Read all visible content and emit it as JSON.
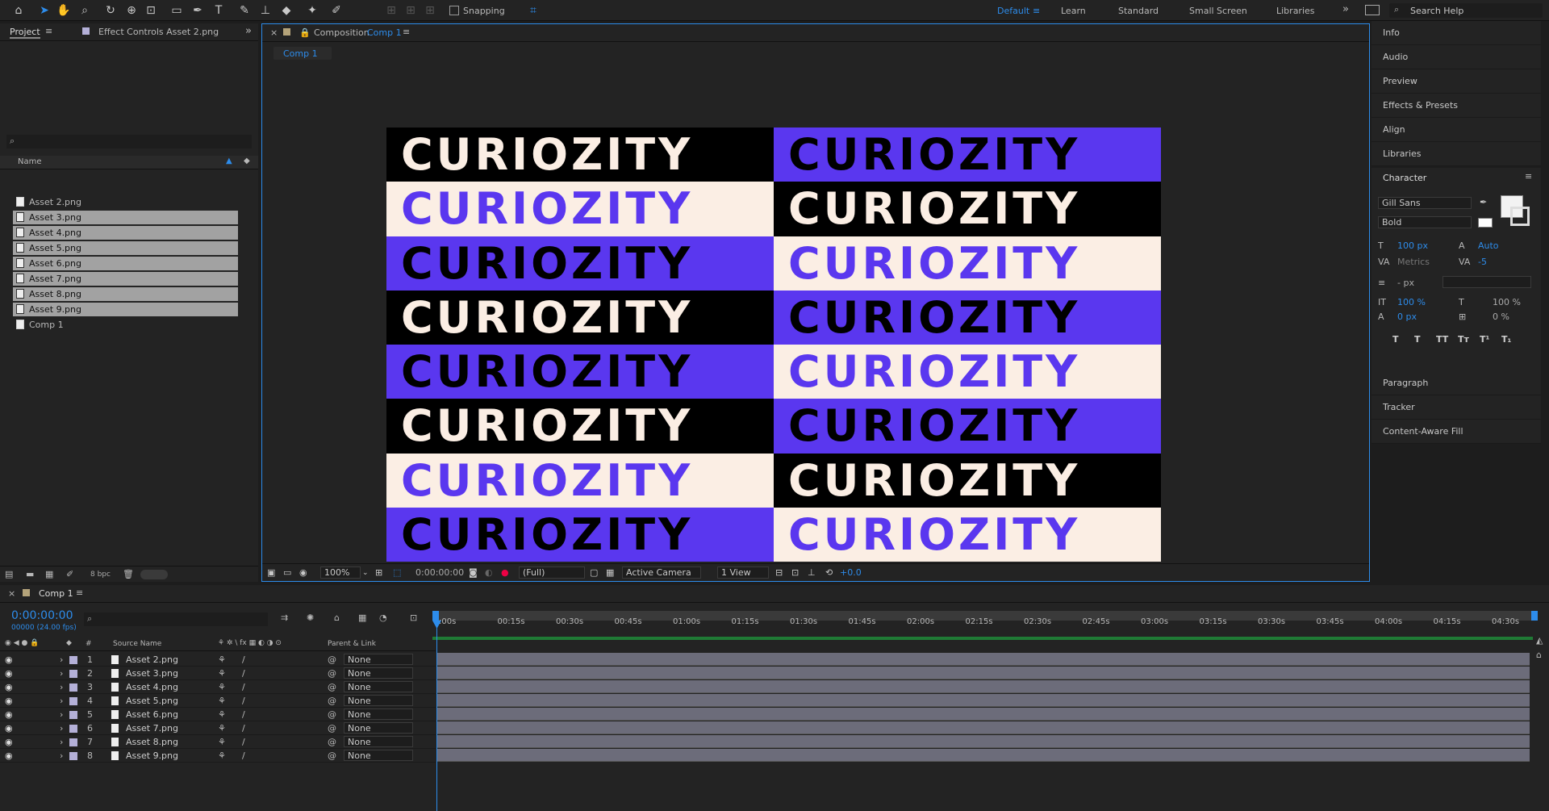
{
  "toolbar": {
    "snapping": "Snapping",
    "workspaces": [
      "Default",
      "Learn",
      "Standard",
      "Small Screen",
      "Libraries"
    ],
    "search_help": "Search Help",
    "active_workspace_color": "#2d8ceb"
  },
  "project_panel": {
    "tab_project": "Project",
    "tab_effect_controls": "Effect Controls Asset 2.png",
    "col_name": "Name",
    "items": [
      {
        "name": "Asset 2.png",
        "selected": false
      },
      {
        "name": "Asset 3.png",
        "selected": true
      },
      {
        "name": "Asset 4.png",
        "selected": true
      },
      {
        "name": "Asset 5.png",
        "selected": true
      },
      {
        "name": "Asset 6.png",
        "selected": true
      },
      {
        "name": "Asset 7.png",
        "selected": true
      },
      {
        "name": "Asset 8.png",
        "selected": true
      },
      {
        "name": "Asset 9.png",
        "selected": true
      },
      {
        "name": "Comp 1",
        "selected": false
      }
    ],
    "bpc": "8 bpc"
  },
  "composition": {
    "tab_prefix": "Composition",
    "tab_name": "Comp 1",
    "sub_tab": "Comp 1",
    "zoom": "100%",
    "timecode": "0:00:00:00",
    "resolution": "(Full)",
    "camera": "Active Camera",
    "views": "1 View",
    "exposure": "+0.0",
    "colors": {
      "purple": "#5a37ef",
      "black": "#000000",
      "cream": "#fbeee4"
    },
    "wordmark": "CURIOZITY",
    "rows": [
      {
        "left": {
          "bg": "black",
          "fg": "cream"
        },
        "right": {
          "bg": "purple",
          "fg": "black"
        }
      },
      {
        "left": {
          "bg": "cream",
          "fg": "purple"
        },
        "right": {
          "bg": "black",
          "fg": "cream"
        }
      },
      {
        "left": {
          "bg": "purple",
          "fg": "black"
        },
        "right": {
          "bg": "cream",
          "fg": "purple"
        }
      },
      {
        "left": {
          "bg": "black",
          "fg": "cream"
        },
        "right": {
          "bg": "purple",
          "fg": "black"
        }
      },
      {
        "left": {
          "bg": "purple",
          "fg": "black"
        },
        "right": {
          "bg": "cream",
          "fg": "purple"
        }
      },
      {
        "left": {
          "bg": "black",
          "fg": "cream"
        },
        "right": {
          "bg": "purple",
          "fg": "black"
        }
      },
      {
        "left": {
          "bg": "cream",
          "fg": "purple"
        },
        "right": {
          "bg": "black",
          "fg": "cream"
        }
      },
      {
        "left": {
          "bg": "purple",
          "fg": "black"
        },
        "right": {
          "bg": "cream",
          "fg": "purple"
        }
      }
    ]
  },
  "right_panel": {
    "items_top": [
      "Info",
      "Audio",
      "Preview",
      "Effects & Presets",
      "Align",
      "Libraries"
    ],
    "character": {
      "title": "Character",
      "font": "Gill Sans",
      "style": "Bold",
      "size": "100 px",
      "leading": "Auto",
      "kerning": "Metrics",
      "tracking": "-5",
      "stroke": "- px",
      "vscale": "100 %",
      "hscale": "100 %",
      "baseline": "0 px",
      "tsume": "0 %",
      "styles": [
        "T",
        "T",
        "TT",
        "Tт",
        "T¹",
        "T₁"
      ]
    },
    "items_bottom": [
      "Paragraph",
      "Tracker",
      "Content-Aware Fill"
    ]
  },
  "timeline": {
    "tab": "Comp 1",
    "timecode": "0:00:00:00",
    "frames": "00000 (24.00 fps)",
    "col_source": "Source Name",
    "col_parent": "Parent & Link",
    "ticks": [
      ":00s",
      "00:15s",
      "00:30s",
      "00:45s",
      "01:00s",
      "01:15s",
      "01:30s",
      "01:45s",
      "02:00s",
      "02:15s",
      "02:30s",
      "02:45s",
      "03:00s",
      "03:15s",
      "03:30s",
      "03:45s",
      "04:00s",
      "04:15s",
      "04:30s"
    ],
    "layers": [
      {
        "num": "1",
        "name": "Asset 2.png",
        "parent": "None"
      },
      {
        "num": "2",
        "name": "Asset 3.png",
        "parent": "None"
      },
      {
        "num": "3",
        "name": "Asset 4.png",
        "parent": "None"
      },
      {
        "num": "4",
        "name": "Asset 5.png",
        "parent": "None"
      },
      {
        "num": "5",
        "name": "Asset 6.png",
        "parent": "None"
      },
      {
        "num": "6",
        "name": "Asset 7.png",
        "parent": "None"
      },
      {
        "num": "7",
        "name": "Asset 8.png",
        "parent": "None"
      },
      {
        "num": "8",
        "name": "Asset 9.png",
        "parent": "None"
      }
    ]
  }
}
